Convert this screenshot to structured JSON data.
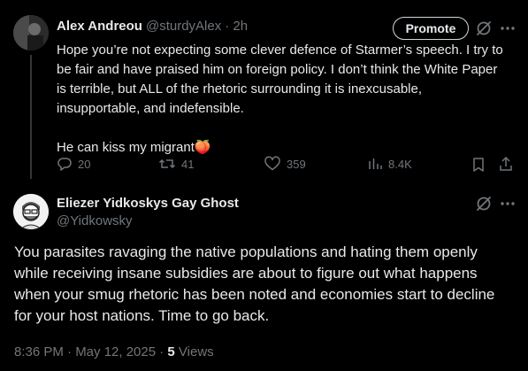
{
  "tweet1": {
    "name": "Alex Andreou",
    "handle": "@sturdyAlex",
    "time": "· 2h",
    "promote_label": "Promote",
    "paragraph1_line1": "Hope you’re not expecting some clever defence of Starmer’s speech. I try to",
    "paragraph1_line2": "be fair and have praised him on foreign policy. I don’t think the White Paper",
    "paragraph1_line3": "is terrible, but ALL of the rhetoric surrounding it is inexcusable,",
    "paragraph1_line4": "insupportable, and indefensible.",
    "paragraph2": "He can kiss my migrant",
    "emoji": "🍑",
    "replies": "20",
    "retweets": "41",
    "likes": "359",
    "views": "8.4K"
  },
  "tweet2": {
    "name": "Eliezer Yidkoskys Gay Ghost",
    "handle": "@Yidkowsky",
    "line1": "You parasites ravaging the native populations and hating them openly",
    "line2": "while receiving insane subsidies are about to figure out what happens",
    "line3": "when your smug rhetoric has been noted and economies start to decline",
    "line4": "for your host nations. Time to go back.",
    "timestamp": "8:36 PM · May 12, 2025 · ",
    "views_count": "5",
    "views_label": " Views"
  },
  "icons": {
    "grok": "grok-slash-circle-icon",
    "more": "more-dots-icon",
    "reply": "reply-bubble-icon",
    "retweet": "retweet-arrows-icon",
    "like": "heart-icon",
    "views": "bar-chart-icon",
    "bookmark": "bookmark-icon",
    "share": "share-upload-icon"
  },
  "colors": {
    "background": "#000000",
    "text": "#e7e9ea",
    "muted": "#71767b",
    "divider": "#2f3336"
  }
}
